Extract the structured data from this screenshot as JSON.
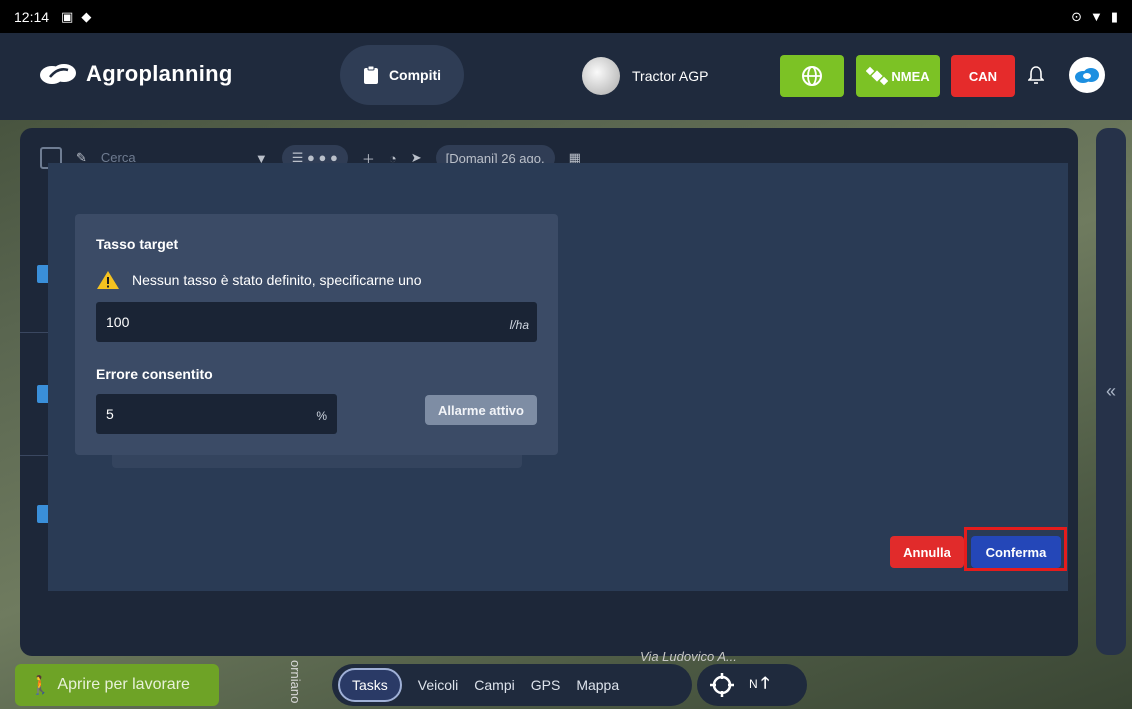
{
  "status_bar": {
    "time": "12:14"
  },
  "header": {
    "app_name": "Agroplanning",
    "tab_active": "Compiti",
    "vehicle_name": "Tractor AGP",
    "nmea_label": "NMEA",
    "can_label": "CAN",
    "colors": {
      "header_bg": "#1f2a3d",
      "green": "#7cc225",
      "red": "#e52b2b"
    }
  },
  "background_toolbar": {
    "search_placeholder": "Cerca",
    "date_filter": "[Domani] 26 ago."
  },
  "dialog": {
    "target_rate_label": "Tasso target",
    "warning_text": "Nessun tasso è stato definito, specificarne uno",
    "target_rate_value": "100",
    "target_rate_unit": "l/ha",
    "allowed_error_label": "Errore consentito",
    "allowed_error_value": "5",
    "allowed_error_unit": "%",
    "alarm_button": "Allarme attivo",
    "cancel_button": "Annulla",
    "confirm_button": "Conferma"
  },
  "bottom": {
    "open_to_work": "Aprire per lavorare",
    "map_text": "orniano",
    "street_text": "Via Ludovico A...",
    "nav_items": [
      "Tasks",
      "Veicoli",
      "Campi",
      "GPS",
      "Mappa"
    ],
    "compass_label": "N"
  }
}
